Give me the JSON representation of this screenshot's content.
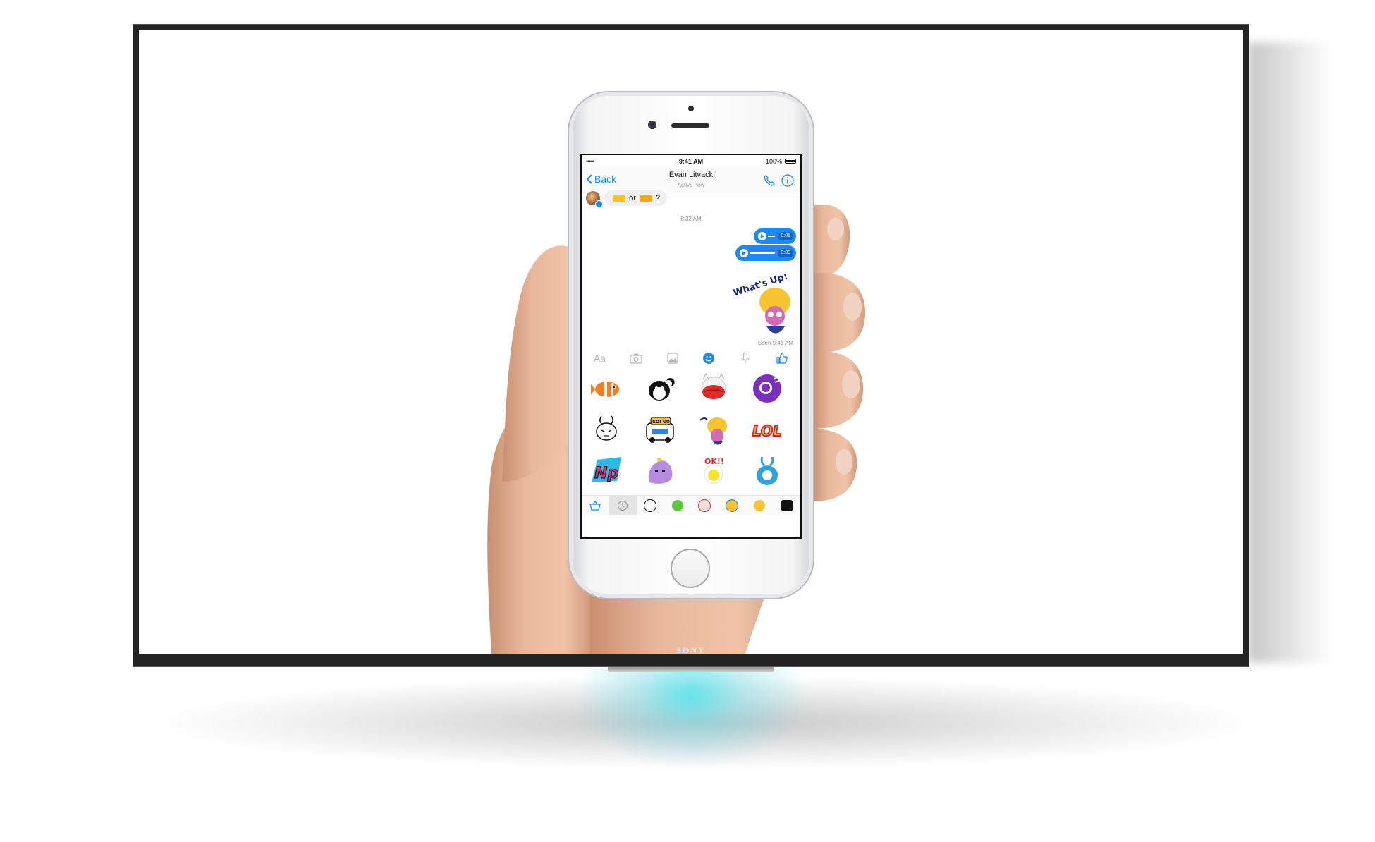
{
  "tv": {
    "brand": "SONY",
    "light_color": "#5fe3ec"
  },
  "phone": {
    "status_bar": {
      "carrier": "••••• ",
      "time": "9:41 AM",
      "battery": "100%"
    },
    "nav": {
      "back_label": "Back",
      "contact_name": "Evan Litvack",
      "contact_status": "Active now",
      "icons": [
        "phone-icon",
        "info-icon"
      ]
    },
    "messages": {
      "incoming_text_or": "or",
      "incoming_text_q": "?",
      "timestamp": "8:32 AM",
      "voice_clips": [
        {
          "duration": "0:05"
        },
        {
          "duration": "0:09"
        }
      ],
      "sticker_caption": "What's Up!",
      "seen": "Seen 9:41 AM"
    },
    "composer": {
      "text_placeholder": "Aa",
      "icons": [
        "camera-icon",
        "photo-gallery-icon",
        "sticker-icon",
        "microphone-icon",
        "thumbs-up-icon"
      ]
    },
    "sticker_grid": {
      "stickers": [
        "clownfish",
        "penguin-with-crescent",
        "red-lips-cat",
        "purple-astronaut",
        "white-bunny",
        "go-go-car",
        "whats-up-turban",
        "lol-text",
        "np-text",
        "lumpy-space-princess",
        "ok-chick",
        "blue-bunny-bubble"
      ],
      "ok_text": "OK!!",
      "lol_text": "LOL",
      "np_text": "Np",
      "go_text": "GO! GO!"
    },
    "sticker_tray": [
      "sticker-store-icon",
      "recent-clock-icon",
      "bunny-pack",
      "green-pack",
      "chick-pack",
      "pack-5",
      "turban-pack",
      "pack-8"
    ],
    "accent": "#1e88f0"
  }
}
